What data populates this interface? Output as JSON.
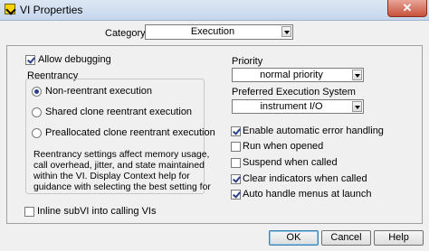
{
  "window": {
    "title": "VI Properties",
    "close_label": "✕"
  },
  "category": {
    "label": "Category",
    "value": "Execution"
  },
  "allow_debugging": {
    "label": "Allow debugging",
    "checked": true
  },
  "reentrancy": {
    "title": "Reentrancy",
    "options": [
      {
        "label": "Non-reentrant execution",
        "selected": true
      },
      {
        "label": "Shared clone reentrant execution",
        "selected": false
      },
      {
        "label": "Preallocated clone reentrant execution",
        "selected": false
      }
    ],
    "note": [
      "Reentrancy settings affect memory usage,",
      "call overhead, jitter, and state maintained",
      "within the VI. Display Context help for",
      "guidance with selecting the best setting for"
    ]
  },
  "inline_subvi": {
    "label": "Inline subVI into calling VIs",
    "checked": false
  },
  "priority": {
    "label": "Priority",
    "value": "normal priority"
  },
  "preferred_exec": {
    "label": "Preferred Execution System",
    "value": "instrument I/O"
  },
  "options": [
    {
      "label": "Enable automatic error handling",
      "checked": true
    },
    {
      "label": "Run when opened",
      "checked": false
    },
    {
      "label": "Suspend when called",
      "checked": false
    },
    {
      "label": "Clear indicators when called",
      "checked": true
    },
    {
      "label": "Auto handle menus at launch",
      "checked": true
    }
  ],
  "buttons": {
    "ok": "OK",
    "cancel": "Cancel",
    "help": "Help"
  }
}
